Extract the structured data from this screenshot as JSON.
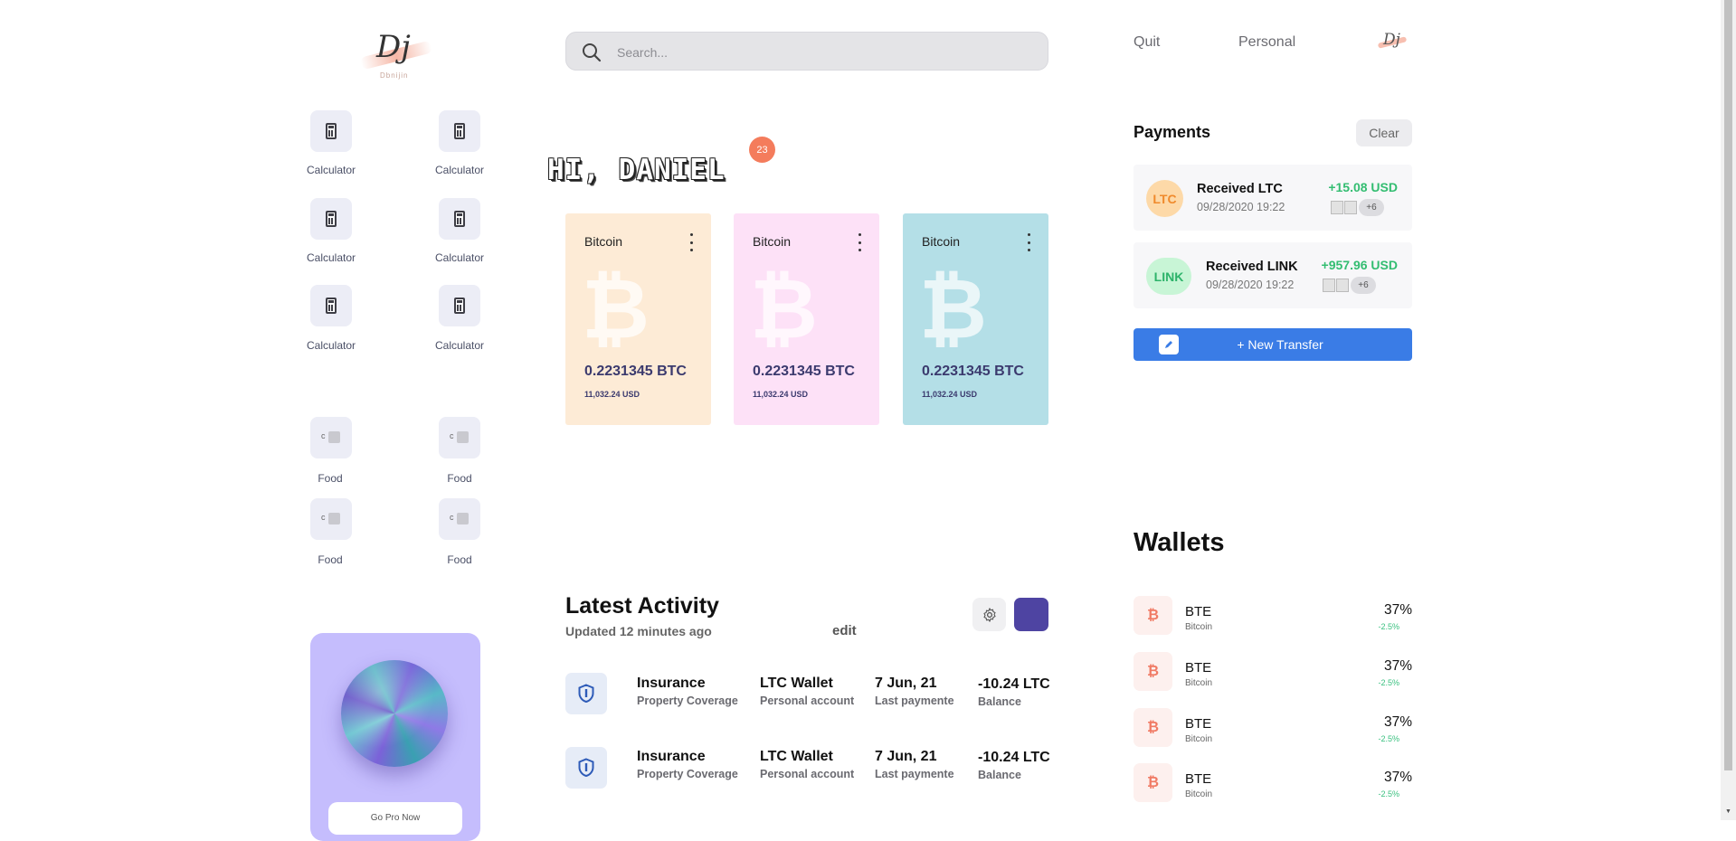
{
  "brand": {
    "logo_text": "Dj",
    "logo_subtext": "Dbnijin"
  },
  "apps": {
    "calculators": [
      {
        "label": "Calculator"
      },
      {
        "label": "Calculator"
      },
      {
        "label": "Calculator"
      },
      {
        "label": "Calculator"
      },
      {
        "label": "Calculator"
      },
      {
        "label": "Calculator"
      }
    ],
    "food": [
      {
        "label": "Food",
        "glyph": "c"
      },
      {
        "label": "Food",
        "glyph": "c"
      },
      {
        "label": "Food",
        "glyph": "c"
      },
      {
        "label": "Food",
        "glyph": "c"
      }
    ]
  },
  "promo": {
    "button_label": "Go Pro Now"
  },
  "search": {
    "placeholder": "Search..."
  },
  "greeting": {
    "text": "HI, DANIEL",
    "notification_count": "23"
  },
  "coins": [
    {
      "name": "Bitcoin",
      "symbol": "₿",
      "amount": "0.2231345 BTC",
      "usd": "11,032.24 USD",
      "color": "#fdebd6"
    },
    {
      "name": "Bitcoin",
      "symbol": "₿",
      "amount": "0.2231345 BTC",
      "usd": "11,032.24 USD",
      "color": "#fde1f7"
    },
    {
      "name": "Bitcoin",
      "symbol": "₿",
      "amount": "0.2231345 BTC",
      "usd": "11,032.24 USD",
      "color": "#b4dfe7"
    }
  ],
  "activity": {
    "title": "Latest Activity",
    "updated": "Updated 12 minutes ago",
    "edit_label": "edit",
    "rows": [
      {
        "title": "Insurance",
        "subtitle": "Property Coverage",
        "wallet": "LTC Wallet",
        "wallet_sub": "Personal account",
        "date": "7 Jun, 21",
        "date_sub": "Last paymente",
        "amount": "-10.24 LTC",
        "amount_sub": "Balance"
      },
      {
        "title": "Insurance",
        "subtitle": "Property Coverage",
        "wallet": "LTC Wallet",
        "wallet_sub": "Personal account",
        "date": "7 Jun, 21",
        "date_sub": "Last paymente",
        "amount": "-10.24 LTC",
        "amount_sub": "Balance"
      }
    ]
  },
  "header": {
    "quit_label": "Quit",
    "personal_label": "Personal",
    "mini_logo_text": "Dj"
  },
  "payments": {
    "title": "Payments",
    "clear_label": "Clear",
    "items": [
      {
        "coin": "LTC",
        "title": "Received LTC",
        "date": "09/28/2020 19:22",
        "amount": "+15.08 USD",
        "more": "+6",
        "coin_bg": "#fdd9a8",
        "coin_fg": "#f08a2c"
      },
      {
        "coin": "LINK",
        "title": "Received LINK",
        "date": "09/28/2020 19:22",
        "amount": "+957.96 USD",
        "more": "+6",
        "coin_bg": "#c8f5d6",
        "coin_fg": "#2db36a"
      }
    ],
    "new_transfer_label": "+   New Transfer"
  },
  "wallets": {
    "title": "Wallets",
    "items": [
      {
        "icon": "₿",
        "code": "BTE",
        "name": "Bitcoin",
        "percent": "37%",
        "change": "-2.5%"
      },
      {
        "icon": "₿",
        "code": "BTE",
        "name": "Bitcoin",
        "percent": "37%",
        "change": "-2.5%"
      },
      {
        "icon": "₿",
        "code": "BTE",
        "name": "Bitcoin",
        "percent": "37%",
        "change": "-2.5%"
      },
      {
        "icon": "₿",
        "code": "BTE",
        "name": "Bitcoin",
        "percent": "37%",
        "change": "-2.5%"
      }
    ]
  },
  "colors": {
    "accent": "#3a7ce6",
    "badge": "#f47c5c",
    "positive": "#33bd71",
    "purple": "#4e44a2"
  }
}
